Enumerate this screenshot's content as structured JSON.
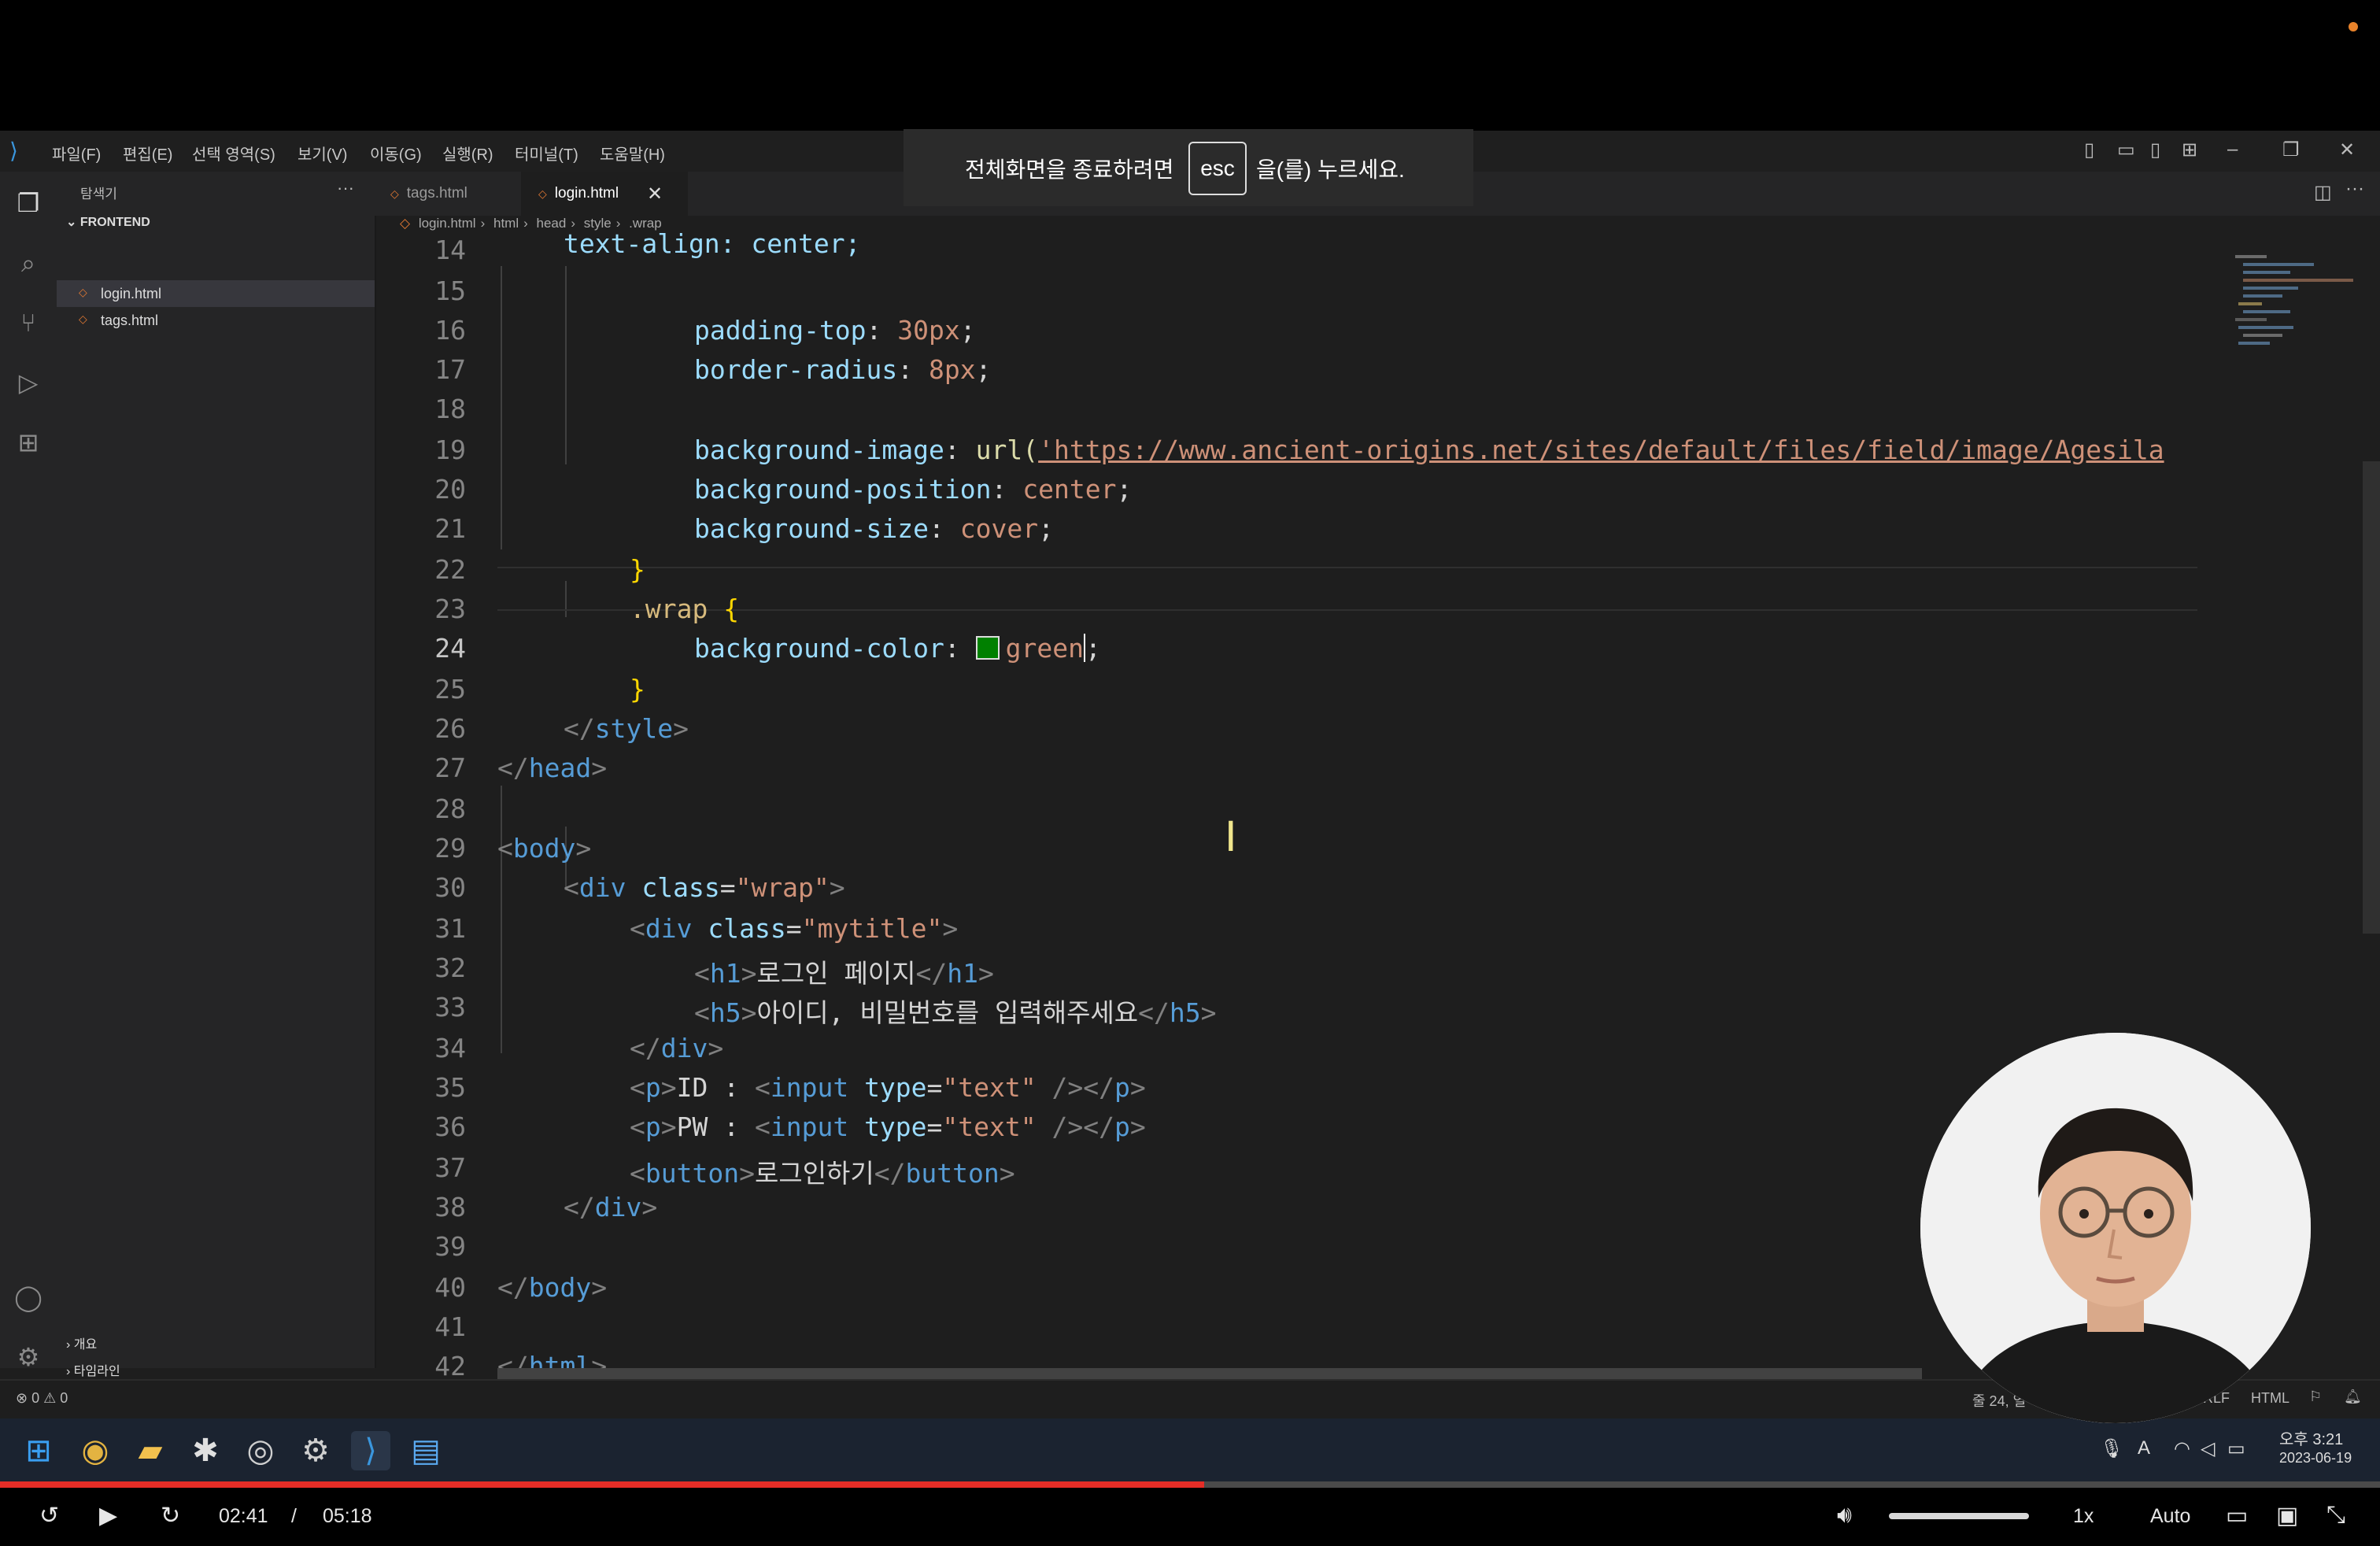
{
  "fullscreen_notice": {
    "before": "전체화면을 종료하려면",
    "key": "esc",
    "after": "을(를) 누르세요."
  },
  "menu": [
    "파일(F)",
    "편집(E)",
    "선택 영역(S)",
    "보기(V)",
    "이동(G)",
    "실행(R)",
    "터미널(T)",
    "도움말(H)"
  ],
  "sidebar": {
    "title": "탐색기",
    "folder": "FRONTEND",
    "files": [
      "login.html",
      "tags.html"
    ],
    "sections": [
      "개요",
      "타임라인"
    ]
  },
  "tabs": [
    {
      "label": "tags.html"
    },
    {
      "label": "login.html"
    }
  ],
  "breadcrumb": [
    "login.html",
    "html",
    "head",
    "style",
    ".wrap"
  ],
  "editor": {
    "line_numbers": [
      "14",
      "15",
      "16",
      "17",
      "18",
      "19",
      "20",
      "21",
      "22",
      "23",
      "24",
      "25",
      "26",
      "27",
      "28",
      "29",
      "30",
      "31",
      "32",
      "33",
      "34",
      "35",
      "36",
      "37",
      "38",
      "39",
      "40",
      "41",
      "42"
    ],
    "t14": "text-align: center;",
    "l16p": "padding-top",
    "l16v": "30px",
    "l17p": "border-radius",
    "l17v": "8px",
    "l19p": "background-image",
    "l19f": "url(",
    "l19u": "'https://www.ancient-origins.net/sites/default/files/field/image/Agesila",
    "l20p": "background-position",
    "l20v": "center",
    "l21p": "background-size",
    "l21v": "cover",
    "l23s": ".wrap",
    "l24p": "background-color",
    "l24v": "green",
    "style_close": "style",
    "head_close": "head",
    "body_open": "body",
    "div": "div",
    "class_attr": "class",
    "wrap_val": "\"wrap\"",
    "mytitle_val": "\"mytitle\"",
    "h1_tag": "h1",
    "h1_text": "로그인 페이지",
    "h5_tag": "h5",
    "h5_text": "아이디, 비밀번호를 입력해주세요",
    "p_tag": "p",
    "id_label": "ID : ",
    "pw_label": "PW : ",
    "input_tag": "input",
    "type_attr": "type",
    "text_val": "\"text\"",
    "button_tag": "button",
    "button_text": "로그인하기",
    "body_close": "body",
    "html_close": "html"
  },
  "statusbar": {
    "problems": "0 ⚠ 0",
    "cursor": "줄 24, 열",
    "eol": "CRLF",
    "lang": "HTML"
  },
  "taskbar": {
    "time": "오후 3:21",
    "date": "2023-06-19"
  },
  "video": {
    "current": "02:41",
    "separator": "/",
    "duration": "05:18",
    "speed": "1x",
    "quality": "Auto",
    "progress": 0.506
  }
}
